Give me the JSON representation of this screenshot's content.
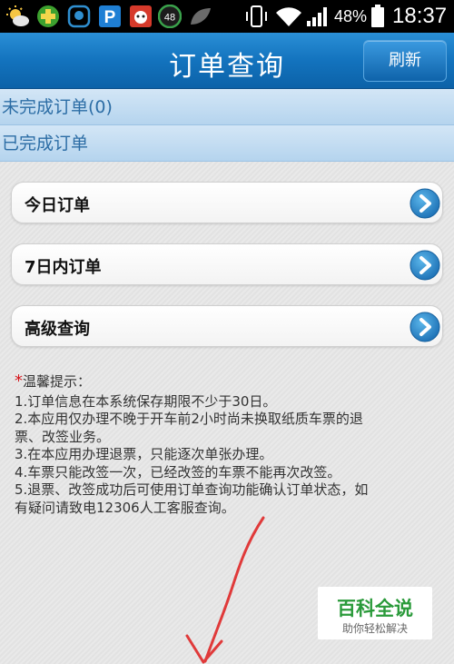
{
  "status_bar": {
    "badge_count": "48",
    "battery_percent": "48%",
    "time": "18:37"
  },
  "header": {
    "title": "订单查询",
    "refresh_label": "刷新"
  },
  "sections": {
    "incomplete_label": "未完成订单(0)",
    "completed_label": "已完成订单"
  },
  "menu": [
    {
      "label": "今日订单"
    },
    {
      "label": "7日内订单"
    },
    {
      "label": "高级查询"
    }
  ],
  "tips": {
    "star": "*",
    "heading": "温馨提示：",
    "lines": [
      "1.订单信息在本系统保存期限不少于30日。",
      "2.本应用仅办理不晚于开车前2小时尚未换取纸质车票的退",
      "票、改签业务。",
      "3.在本应用办理退票，只能逐次单张办理。",
      "4.车票只能改签一次，已经改签的车票不能再次改签。",
      "5.退票、改签成功后可使用订单查询功能确认订单状态，如",
      "有疑问请致电12306人工客服查询。"
    ]
  },
  "watermark": {
    "title": "百科全说",
    "subtitle": "助你轻松解决"
  },
  "colors": {
    "title_bar": "#1373be",
    "section_text": "#2c6da5",
    "arrow_button": "#2f8fd0",
    "annotation_red": "#e03a3a",
    "watermark_green": "#2a9a3a"
  }
}
